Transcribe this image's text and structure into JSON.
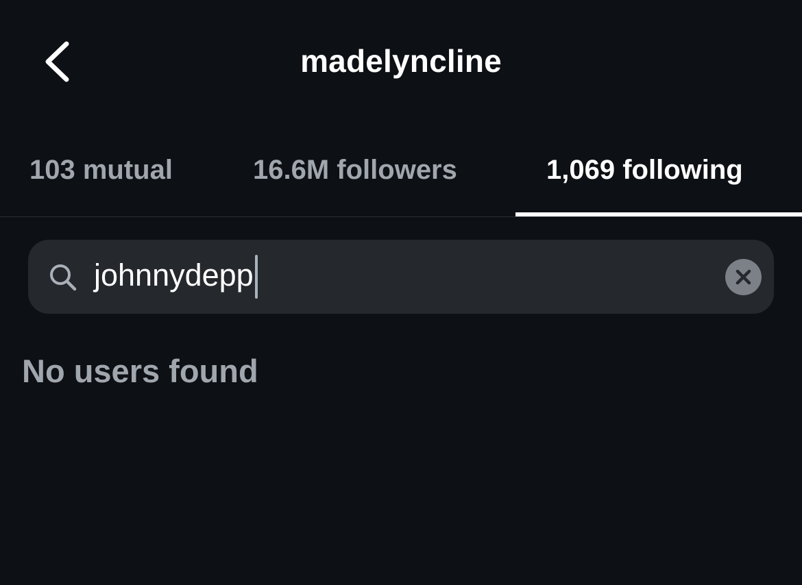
{
  "header": {
    "title": "madelyncline",
    "back_icon": "chevron-left-icon"
  },
  "tabs": [
    {
      "label": "103 mutual",
      "active": false
    },
    {
      "label": "16.6M followers",
      "active": false
    },
    {
      "label": "1,069 following",
      "active": true
    }
  ],
  "search": {
    "value": "johnnydepp",
    "search_icon": "search-icon",
    "clear_icon": "clear-icon"
  },
  "results": {
    "empty_message": "No users found"
  },
  "colors": {
    "background": "#0d1014",
    "search_background": "#25282d",
    "text_primary": "#ffffff",
    "text_secondary": "#a0a6ad",
    "divider": "#2b3036",
    "clear_button": "#7c8087"
  }
}
